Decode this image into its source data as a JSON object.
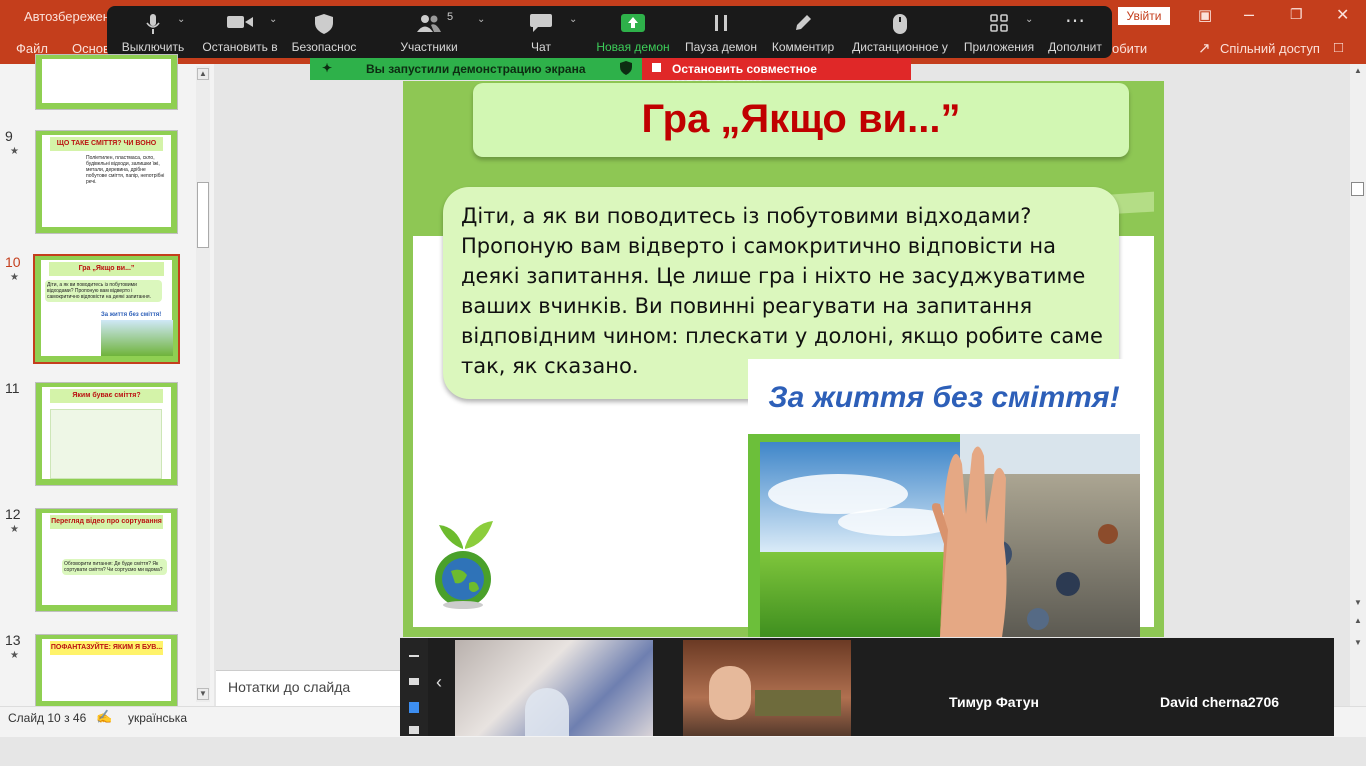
{
  "powerpoint": {
    "autosave_label": "Автозбережен",
    "login_label": "Увійти",
    "ribbon": {
      "file": "Файл",
      "home": "Основ",
      "tail": "обити",
      "share": "Спільний доступ"
    },
    "notes_label": "Нотатки до слайда",
    "status": {
      "slide_counter": "Слайд 10 з 46",
      "language": "українська"
    }
  },
  "zoom_toolbar": {
    "mute": "Выключить",
    "stop_video": "Остановить в",
    "security": "Безопаснос",
    "participants": "Участники",
    "participants_count": "5",
    "chat": "Чат",
    "new_share": "Новая демон",
    "pause_share": "Пауза демон",
    "annotate": "Комментир",
    "remote_control": "Дистанционное у",
    "apps": "Приложения",
    "more": "Дополнит"
  },
  "share_banner": {
    "notice": "Вы запустили демонстрацию экрана",
    "stop": "Остановить совместное использование"
  },
  "thumbnails": [
    {
      "num": "9",
      "title": "ЩО ТАКЕ СМІТТЯ? ЧИ ВОНО ЗАГРОЖУЄ ЗДОРОВ'Ю ЛЮДЕЙ?",
      "body": "Поліетилен, пластмаса, скло, будівельні відходи, залишки їжі, метали, деревина, дрібне побутове сміття, папір, непотрібні речі."
    },
    {
      "num": "10",
      "title": "Гра „Якщо ви...”",
      "body": "Діти, а як ви поводитесь із побутовими відходами? Пропоную вам відверто і самокритично відповісти на деякі запитання.",
      "poster": "За життя без сміття!"
    },
    {
      "num": "11",
      "title": "Яким буває сміття?",
      "body": ""
    },
    {
      "num": "12",
      "title": "Перегляд відео про сортування сміття",
      "body": "Обговорити питання: Де буде сміття? Як сортувати сміття? Чи сортуємо ми вдома?"
    },
    {
      "num": "13",
      "title": "ПОФАНТАЗУЙТЕ: ЯКИМ Я БУВ... ЯК ЖИТТЯ МИ, ЩОБ З МЕНЕ ЗРОБИЛИ...",
      "body": ""
    }
  ],
  "slide": {
    "title": "Гра „Якщо ви...”",
    "body": "Діти, а як ви поводитесь із побутовими відходами? Пропоную вам відверто і самокритично відповісти на деякі запитання. Це лише гра і ніхто не засуджуватиме ваших вчинків. Ви повинні реагувати на запитання відповідним чином: плескати у долоні, якщо робите саме так, як сказано.",
    "poster_title": "За життя без сміття!"
  },
  "participants": [
    {
      "name": "Тимур Фатун"
    },
    {
      "name": "David cherna2706"
    }
  ],
  "colors": {
    "ppt_red": "#c43e1c",
    "zoom_green": "#2eb14a",
    "zoom_red": "#e02828",
    "slide_green": "#8ec754",
    "title_red": "#c00000"
  }
}
